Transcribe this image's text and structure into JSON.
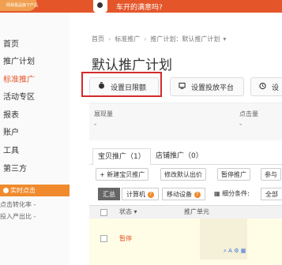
{
  "header": {
    "tagline": "网易极品旗下产品",
    "promo_text": "车开的满意吗?"
  },
  "sidebar": {
    "items": [
      {
        "label": "首页",
        "active": false
      },
      {
        "label": "推广计划",
        "active": false
      },
      {
        "label": "标准推广",
        "active": true
      },
      {
        "label": "活动专区",
        "active": false
      },
      {
        "label": "报表",
        "active": false
      },
      {
        "label": "账户",
        "active": false
      },
      {
        "label": "工具",
        "active": false
      },
      {
        "label": "第三方",
        "active": false
      }
    ],
    "section_label": "实时点击",
    "small_items": [
      "点击转化率 -",
      "投入产出比 -"
    ]
  },
  "breadcrumb": {
    "items": [
      "首页",
      "标准推广",
      "推广计划：默认推广计划"
    ]
  },
  "page_title": "默认推广计划",
  "buttons": {
    "daily_limit": "设置日限额",
    "platform": "设置投放平台",
    "third": "设"
  },
  "stats": {
    "impressions_label": "展现量",
    "impressions_value": "-",
    "clicks_label": "点击量",
    "clicks_value": "-"
  },
  "tabs": [
    {
      "label": "宝贝推广（1）",
      "active": true
    },
    {
      "label": "店铺推广（0）",
      "active": false
    }
  ],
  "actions": {
    "new": "+ 新建宝贝推广",
    "modify_bid": "修改默认出价",
    "pause": "暂停推广",
    "join": "参与"
  },
  "filters": {
    "summary": "汇总",
    "computer": "计算机",
    "mobile": "移动设备",
    "segment_label": "细分条件:",
    "segment_value": "全部"
  },
  "table": {
    "headers": {
      "status": "状态",
      "unit": "推广单元"
    },
    "rows": [
      {
        "status": "暂停"
      }
    ]
  },
  "colors": {
    "brand": "#e4562a",
    "accent": "#f08a2c",
    "highlight": "#d42a2a"
  }
}
